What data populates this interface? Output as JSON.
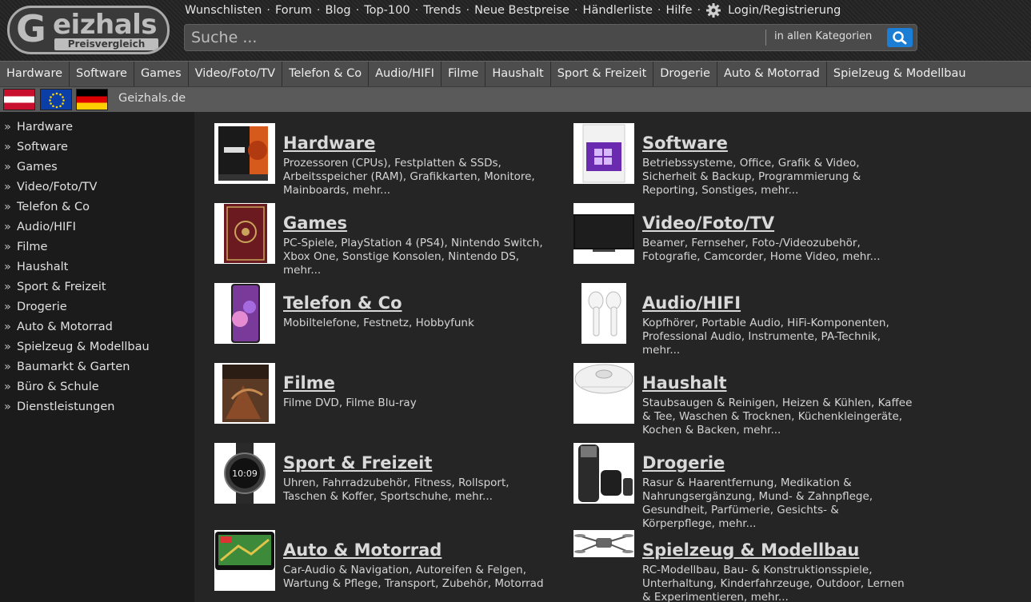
{
  "logo": {
    "word_initial": "G",
    "word_rest": "eizhals",
    "subtitle": "Preisvergleich"
  },
  "topnav": {
    "links": [
      "Wunschlisten",
      "Forum",
      "Blog",
      "Top-100",
      "Trends",
      "Neue Bestpreise",
      "Händlerliste",
      "Hilfe"
    ],
    "separator": "·",
    "gear_icon": "gear-icon",
    "login": "Login/Registrierung"
  },
  "search": {
    "placeholder": "Suche ...",
    "category": "in allen Kategorien",
    "button_icon": "search-icon"
  },
  "catbar": [
    "Hardware",
    "Software",
    "Games",
    "Video/Foto/TV",
    "Telefon & Co",
    "Audio/HIFI",
    "Filme",
    "Haushalt",
    "Sport & Freizeit",
    "Drogerie",
    "Auto & Motorrad",
    "Spielzeug & Modellbau"
  ],
  "country": {
    "flags": [
      "Austria",
      "EU",
      "Germany"
    ],
    "label": "Geizhals.de"
  },
  "sidebar": [
    "Hardware",
    "Software",
    "Games",
    "Video/Foto/TV",
    "Telefon & Co",
    "Audio/HIFI",
    "Filme",
    "Haushalt",
    "Sport & Freizeit",
    "Drogerie",
    "Auto & Motorrad",
    "Spielzeug & Modellbau",
    "Baumarkt & Garten",
    "Büro & Schule",
    "Dienstleistungen"
  ],
  "sidebar_bullet": "»",
  "categories": [
    {
      "title": "Hardware",
      "desc": "Prozessoren (CPUs), Festplatten & SSDs, Arbeitsspeicher (RAM), Grafikkarten, Monitore, Mainboards, mehr...",
      "image": "cpu-box"
    },
    {
      "title": "Software",
      "desc": "Betriebssysteme, Office, Grafik & Video, Sicherheit & Backup, Programmierung & Reporting, Sonstiges, mehr...",
      "image": "software-box"
    },
    {
      "title": "Games",
      "desc": "PC-Spiele, PlayStation 4 (PS4), Nintendo Switch, Xbox One, Sonstige Konsolen, Nintendo DS, mehr...",
      "image": "game-box"
    },
    {
      "title": "Video/Foto/TV",
      "desc": "Beamer, Fernseher, Foto-/Videozubehör, Fotografie, Camcorder, Home Video, mehr...",
      "image": "tv"
    },
    {
      "title": "Telefon & Co",
      "desc": "Mobiltelefone, Festnetz, Hobbyfunk",
      "image": "smartphone"
    },
    {
      "title": "Audio/HIFI",
      "desc": "Kopfhörer, Portable Audio, HiFi-Komponenten, Professional Audio, Instrumente, PA-Technik, mehr...",
      "image": "earbuds"
    },
    {
      "title": "Filme",
      "desc": "Filme DVD, Filme Blu-ray",
      "image": "movie-box"
    },
    {
      "title": "Haushalt",
      "desc": "Staubsaugen & Reinigen, Heizen & Kühlen, Kaffee & Tee, Waschen & Trocknen, Küchenkleingeräte, Kochen & Backen, mehr...",
      "image": "robot-vacuum"
    },
    {
      "title": "Sport & Freizeit",
      "desc": "Uhren, Fahrradzubehör, Fitness, Rollsport, Taschen & Koffer, Sportschuhe, mehr...",
      "image": "smartwatch"
    },
    {
      "title": "Drogerie",
      "desc": "Rasur & Haarentfernung, Medikation & Nahrungsergänzung, Mund- & Zahnpflege, Gesundheit, Parfümerie, Gesichts- & Körperpflege, mehr...",
      "image": "shaver"
    },
    {
      "title": "Auto & Motorrad",
      "desc": "Car-Audio & Navigation, Autoreifen & Felgen, Wartung & Pflege, Transport, Zubehör, Motorrad",
      "image": "navigation-device"
    },
    {
      "title": "Spielzeug & Modellbau",
      "desc": "RC-Modellbau, Bau- & Konstruktionsspiele, Unterhaltung, Kinderfahrzeuge, Outdoor, Lernen & Experimentieren, mehr...",
      "image": "drone"
    }
  ]
}
